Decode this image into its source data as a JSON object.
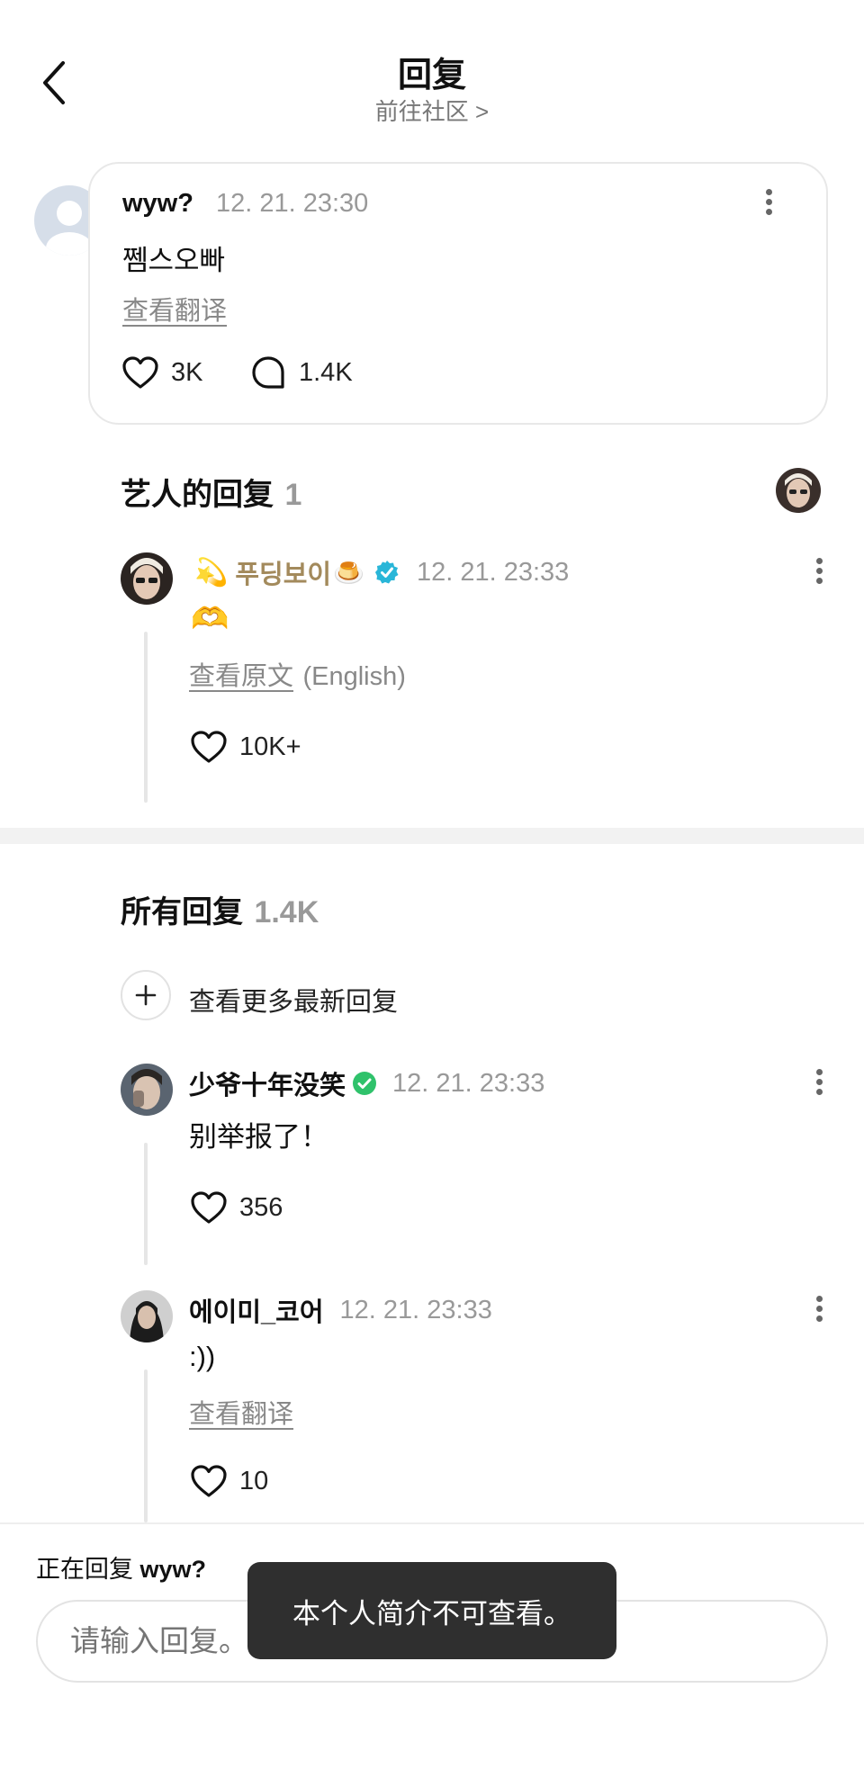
{
  "header": {
    "title": "回复",
    "subtitle": "前往社区 >"
  },
  "main_comment": {
    "username": "wyw?",
    "time": "12. 21. 23:30",
    "text": "쩸스오빠",
    "translate_link": "查看翻译",
    "likes": "3K",
    "replies": "1.4K"
  },
  "artist_replies": {
    "title": "艺人的回复",
    "count": "1",
    "reply": {
      "emoji_prefix": "💫",
      "username": "푸딩보이",
      "emoji_suffix": "🍮",
      "time": "12. 21. 23:33",
      "text": "🫶",
      "view_original_link": "查看原文",
      "original_lang": "(English)",
      "likes": "10K+"
    }
  },
  "all_replies": {
    "title": "所有回复",
    "count": "1.4K",
    "load_more": "查看更多最新回复",
    "items": [
      {
        "username": "少爷十年没笑",
        "time": "12. 21. 23:33",
        "text": "别举报了！",
        "likes": "356"
      },
      {
        "username": "에이미_코어",
        "time": "12. 21. 23:33",
        "text": ":))",
        "translate_link": "查看翻译",
        "likes": "10"
      }
    ]
  },
  "reply_bar": {
    "replying_prefix": "正在回复",
    "replying_to": "wyw?",
    "placeholder": "请输入回复。"
  },
  "toast": {
    "text": "本个人简介不可查看。"
  },
  "colors": {
    "verified_blue": "#29b6d8",
    "verified_green": "#2fc26b",
    "artist_gold": "#a38a5c"
  }
}
